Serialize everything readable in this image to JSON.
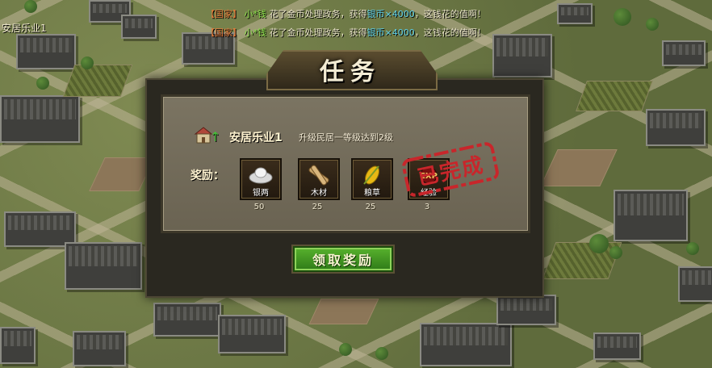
{
  "hud": {
    "corner_label": "安居乐业1",
    "chat": [
      {
        "channel": "【国家】",
        "player": "小*钱",
        "action": "花了",
        "money_cost": "金币",
        "task": "处理政务，获得",
        "reward_type": "银币",
        "reward_amount": "×4000",
        "suffix": "，这钱花的值啊！"
      },
      {
        "channel": "【国家】",
        "player": "小*钱",
        "action": "花了",
        "money_cost": "金币",
        "task": "处理政务，获得",
        "reward_type": "银币",
        "reward_amount": "×4000",
        "suffix": "，这钱花的值啊！"
      }
    ]
  },
  "dialog": {
    "title": "任务",
    "quest": {
      "icon": "house-upgrade-icon",
      "arrow": "↑",
      "name": "安居乐业1",
      "description": "升级民居一等级达到2级"
    },
    "rewards_label": "奖励：",
    "rewards": [
      {
        "name": "银两",
        "count": "50",
        "icon": "silver-ingot-icon"
      },
      {
        "name": "木材",
        "count": "25",
        "icon": "wood-logs-icon"
      },
      {
        "name": "粮草",
        "count": "25",
        "icon": "grain-icon"
      },
      {
        "name": "经验",
        "count": "3",
        "icon": "exp-icon"
      }
    ],
    "stamp_text": "已完成",
    "claim_button": "领取奖励"
  },
  "colors": {
    "accent_green": "#3f9a1f",
    "stamp_red": "#c8262b",
    "channel_orange": "#e07b3a"
  }
}
